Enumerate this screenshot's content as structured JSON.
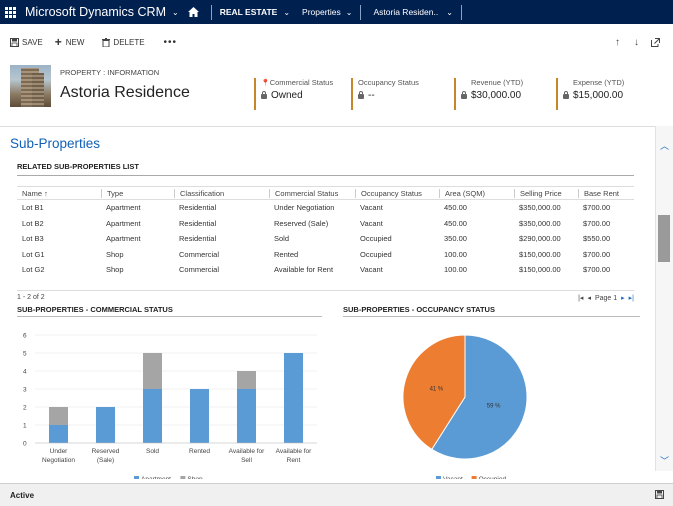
{
  "nav": {
    "brand": "Microsoft Dynamics CRM",
    "area": "REAL ESTATE",
    "entity": "Properties",
    "record": "Astoria Residen.."
  },
  "commands": {
    "save": "SAVE",
    "new": "NEW",
    "delete": "DELETE",
    "more": "•••"
  },
  "header": {
    "entity_label": "PROPERTY : INFORMATION",
    "title": "Astoria Residence",
    "fields": [
      {
        "label": "Commercial Status",
        "value": "Owned"
      },
      {
        "label": "Occupancy Status",
        "value": "--"
      },
      {
        "label": "Revenue (YTD)",
        "value": "$30,000.00"
      },
      {
        "label": "Expense (YTD)",
        "value": "$15,000.00"
      }
    ]
  },
  "section": {
    "title": "Sub-Properties",
    "list_title": "RELATED SUB-PROPERTIES LIST"
  },
  "table": {
    "columns": [
      "Name",
      "Type",
      "Classification",
      "Commercial Status",
      "Occupancy Status",
      "Area (SQM)",
      "Selling Price",
      "Base Rent"
    ],
    "sort_indicator": "↑",
    "rows": [
      [
        "Lot B1",
        "Apartment",
        "Residential",
        "Under Negotiation",
        "Vacant",
        "450.00",
        "$350,000.00",
        "$700.00"
      ],
      [
        "Lot B2",
        "Apartment",
        "Residential",
        "Reserved (Sale)",
        "Vacant",
        "450.00",
        "$350,000.00",
        "$700.00"
      ],
      [
        "Lot B3",
        "Apartment",
        "Residential",
        "Sold",
        "Occupied",
        "350.00",
        "$290,000.00",
        "$550.00"
      ],
      [
        "Lot G1",
        "Shop",
        "Commercial",
        "Rented",
        "Occupied",
        "100.00",
        "$150,000.00",
        "$700.00"
      ],
      [
        "Lot G2",
        "Shop",
        "Commercial",
        "Available for Rent",
        "Vacant",
        "100.00",
        "$150,000.00",
        "$700.00"
      ]
    ],
    "record_count": "1 - 2 of 2",
    "page_label": "Page 1"
  },
  "chart_data": [
    {
      "type": "bar",
      "title": "SUB-PROPERTIES - COMMERCIAL STATUS",
      "categories": [
        "Under Negotiation",
        "Reserved (Sale)",
        "Sold",
        "Rented",
        "Available for Sell",
        "Available for Rent"
      ],
      "category_lines": [
        [
          "Under",
          "Negotiation"
        ],
        [
          "Reserved",
          "(Sale)"
        ],
        [
          "Sold"
        ],
        [
          "Rented"
        ],
        [
          "Available for",
          "Sell"
        ],
        [
          "Available for",
          "Rent"
        ]
      ],
      "series": [
        {
          "name": "Apartment",
          "color": "#5b9bd5",
          "values": [
            1,
            2,
            3,
            3,
            3,
            5
          ]
        },
        {
          "name": "Shop",
          "color": "#a5a5a5",
          "values": [
            1,
            0,
            2,
            0,
            1,
            0
          ]
        }
      ],
      "stacked": true,
      "ylim": [
        0,
        6
      ],
      "yticks": [
        "0",
        "1",
        "2",
        "3",
        "4",
        "5",
        "6"
      ],
      "legend": "bottom"
    },
    {
      "type": "pie",
      "title": "SUB-PROPERTIES - OCCUPANCY STATUS",
      "slices": [
        {
          "name": "Vacant",
          "value": 59,
          "label": "59 %",
          "color": "#5b9bd5"
        },
        {
          "name": "Occupied",
          "value": 41,
          "label": "41 %",
          "color": "#ed7d31"
        }
      ],
      "legend": "bottom"
    }
  ],
  "status": {
    "label": "Active"
  }
}
